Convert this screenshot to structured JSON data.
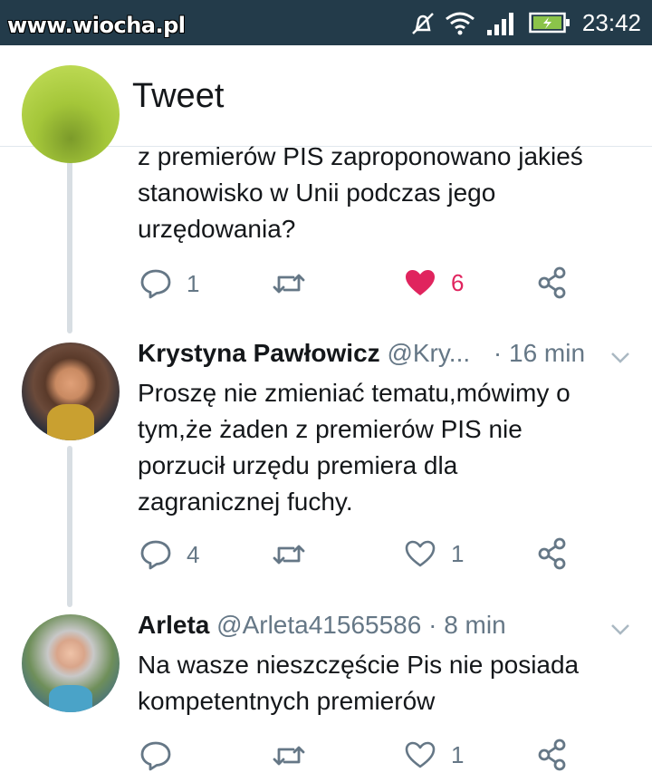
{
  "status_bar": {
    "watermark": "www.wiocha.pl",
    "time": "23:42"
  },
  "app_bar": {
    "title": "Tweet"
  },
  "tweets": [
    {
      "text": "z premierów PIS zaproponowano jakieś\nstanowisko w Unii podczas jego\nurzędowania?",
      "replies": "1",
      "likes": "6"
    },
    {
      "name": "Krystyna Pawłowicz",
      "handle": "@Kry...",
      "time": "· 16 min",
      "text": "Proszę nie zmieniać tematu,mówimy o\ntym,że żaden z premierów PIS nie\nporzucił urzędu premiera dla\nzagranicznej fuchy.",
      "replies": "4",
      "likes": "1"
    },
    {
      "name": "Arleta",
      "handle": "@Arleta41565586",
      "time": "· 8 min",
      "text": "Na wasze nieszczęście Pis nie posiada\nkompetentnych premierów",
      "replies": "",
      "likes": "1"
    }
  ],
  "colors": {
    "accent": "#1da1f2",
    "like": "#e0245e",
    "secondary_text": "#657786",
    "status_bar": "#233b4a"
  }
}
